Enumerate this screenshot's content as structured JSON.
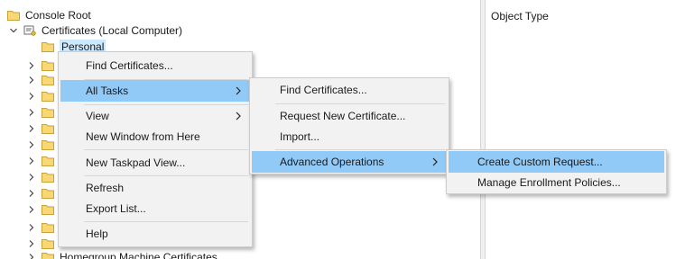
{
  "tree": {
    "root_label": "Console Root",
    "store_label": "Certificates (Local Computer)",
    "personal_label": "Personal",
    "bottom_label": "Homegroup Machine Certificates"
  },
  "right_pane": {
    "column_header": "Object Type"
  },
  "context_menu": {
    "find_certificates": "Find Certificates...",
    "all_tasks": "All Tasks",
    "view": "View",
    "new_window": "New Window from Here",
    "new_taskpad": "New Taskpad View...",
    "refresh": "Refresh",
    "export_list": "Export List...",
    "help": "Help"
  },
  "all_tasks_menu": {
    "find_certificates": "Find Certificates...",
    "request_new_certificate": "Request New Certificate...",
    "import": "Import...",
    "advanced_operations": "Advanced Operations"
  },
  "advanced_menu": {
    "create_custom_request": "Create Custom Request...",
    "manage_enrollment_policies": "Manage Enrollment Policies..."
  },
  "colors": {
    "highlight": "#91c9f7",
    "selection": "#cce8ff",
    "menu_bg": "#f2f2f2",
    "folder": "#f8d775"
  },
  "icons": {
    "folder": "folder-icon",
    "certificate_store": "certificate-store-icon",
    "expand": "chevron-right-icon",
    "collapse": "chevron-down-icon",
    "submenu": "submenu-arrow-icon"
  }
}
